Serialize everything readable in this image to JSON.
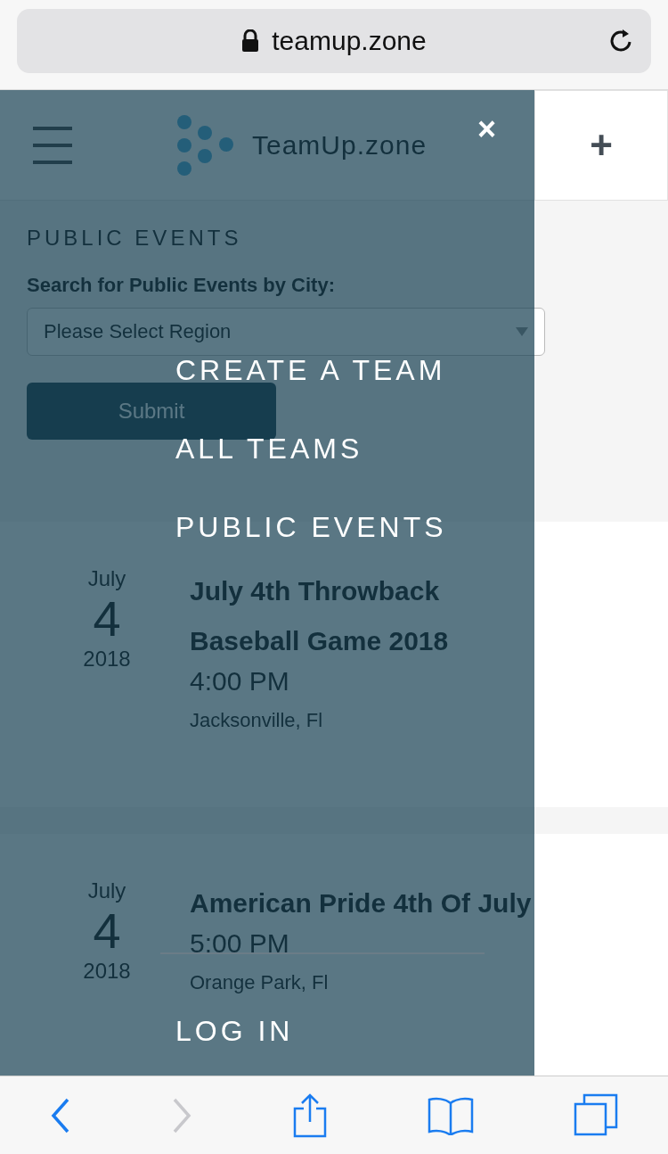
{
  "browser": {
    "url": "teamup.zone",
    "back_enabled": true,
    "forward_enabled": false
  },
  "header": {
    "brand": "TeamUp.zone",
    "add_button": "+"
  },
  "section": {
    "title": "PUBLIC EVENTS",
    "search_label": "Search for Public Events by City:",
    "region_select": {
      "placeholder": "Please Select Region"
    },
    "submit": "Submit"
  },
  "events": [
    {
      "month": "July",
      "day": "4",
      "year": "2018",
      "title": "July 4th Throwback Baseball Game 2018",
      "time": "4:00 PM",
      "location": "Jacksonville, Fl"
    },
    {
      "month": "July",
      "day": "4",
      "year": "2018",
      "title": "American Pride 4th Of July",
      "time": "5:00 PM",
      "location": "Orange Park, Fl"
    }
  ],
  "menu": {
    "close": "×",
    "items": [
      "CREATE A TEAM",
      "ALL TEAMS",
      "PUBLIC EVENTS"
    ],
    "login": "LOG IN"
  }
}
